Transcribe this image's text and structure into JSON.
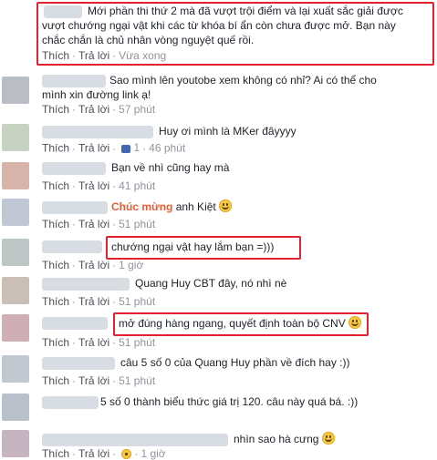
{
  "labels": {
    "like": "Thích",
    "reply": "Trả lời",
    "dot": "·"
  },
  "comments": [
    {
      "lines": [
        "Mới phần thi thứ 2 mà đã vượt trội điểm và lại xuất sắc giải được",
        "vượt chướng ngại vật khi các từ khóa bí ẩn còn chưa được mở. Bạn này",
        "chắc chắn là chủ nhân vòng nguyệt quế rồi."
      ],
      "time": "Vừa xong"
    },
    {
      "lines": [
        "Sao mình lên youtobe xem không có nhỉ? Ai có thể cho",
        "mình xin đường link ạ!"
      ],
      "time": "57 phút"
    },
    {
      "lines": [
        "Huy ơi mình là MKer đâyyyy"
      ],
      "replies": "1",
      "time": "46 phút"
    },
    {
      "lines": [
        "Bạn về nhì cũng hay mà"
      ],
      "time": "41 phút"
    },
    {
      "prefix": "Chúc mừng",
      "lines": [
        "anh Kiệt"
      ],
      "time": "51 phút"
    },
    {
      "lines": [
        "chướng ngại vật hay lắm bạn =)))"
      ],
      "time": "1 giờ"
    },
    {
      "lines": [
        "Quang Huy CBT đây, nó nhì nè"
      ],
      "time": "51 phút"
    },
    {
      "lines": [
        "mở đúng hàng ngang, quyết định toàn bộ CNV"
      ],
      "time": "51 phút"
    },
    {
      "lines": [
        "câu 5 số 0 của Quang Huy phần về đích hay :))"
      ],
      "time": "51 phút"
    },
    {
      "lines": [
        "5 số 0 thành biểu thức giá trị 120. câu này quá bá. :))"
      ],
      "time": ""
    },
    {
      "lines": [
        "nhìn sao hà cưng"
      ],
      "time": "1 giờ"
    }
  ],
  "colors": {
    "highlight": "#e0232f",
    "link": "#4267b2",
    "meta": "#90949c",
    "accent_orange": "#e85d36"
  },
  "icons": [
    "smile-emoji-icon",
    "reply-bubble-icon",
    "laugh-emoji-icon"
  ]
}
